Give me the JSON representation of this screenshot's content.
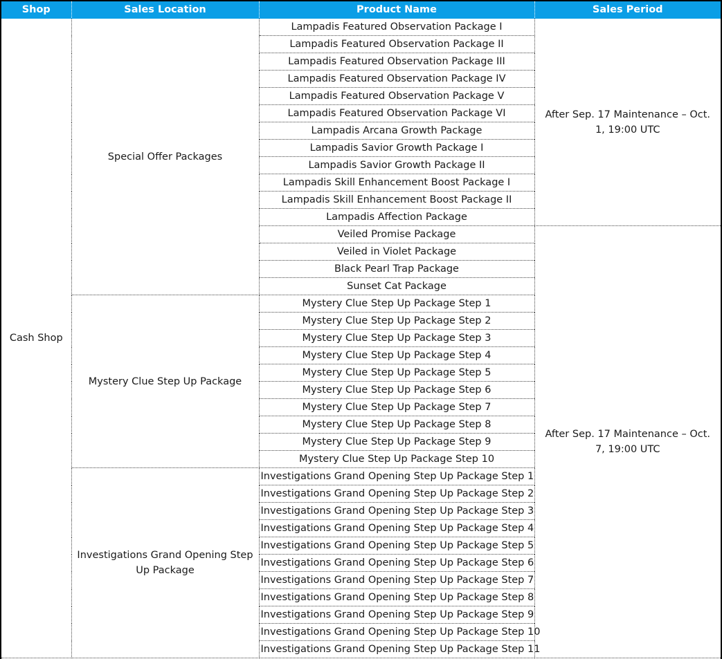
{
  "headers": {
    "shop": "Shop",
    "sales_location": "Sales Location",
    "product_name": "Product Name",
    "sales_period": "Sales Period"
  },
  "shop": "Cash Shop",
  "locations": [
    "Special Offer Packages",
    "Mystery Clue Step Up Package",
    "Investigations Grand Opening Step Up Package"
  ],
  "periods": [
    "After Sep. 17 Maintenance – Oct. 1, 19:00 UTC",
    "After Sep. 17 Maintenance – Oct. 7, 19:00 UTC"
  ],
  "products": [
    "Lampadis Featured Observation Package I",
    "Lampadis Featured Observation Package II",
    "Lampadis Featured Observation Package III",
    "Lampadis Featured Observation Package IV",
    "Lampadis Featured Observation Package V",
    "Lampadis Featured Observation Package VI",
    "Lampadis Arcana Growth Package",
    "Lampadis Savior Growth Package I",
    "Lampadis Savior Growth Package II",
    "Lampadis Skill Enhancement Boost Package I",
    "Lampadis Skill Enhancement Boost Package II",
    "Lampadis Affection Package",
    "Veiled Promise Package",
    "Veiled in Violet Package",
    "Black Pearl Trap Package",
    "Sunset Cat Package",
    "Mystery Clue Step Up Package Step 1",
    "Mystery Clue Step Up Package Step 2",
    "Mystery Clue Step Up Package Step 3",
    "Mystery Clue Step Up Package Step 4",
    "Mystery Clue Step Up Package Step 5",
    "Mystery Clue Step Up Package Step 6",
    "Mystery Clue Step Up Package Step 7",
    "Mystery Clue Step Up Package Step 8",
    "Mystery Clue Step Up Package Step 9",
    "Mystery Clue Step Up Package Step 10",
    "Investigations Grand Opening Step Up Package Step 1",
    "Investigations Grand Opening Step Up Package Step 2",
    "Investigations Grand Opening Step Up Package Step 3",
    "Investigations Grand Opening Step Up Package Step 4",
    "Investigations Grand Opening Step Up Package Step 5",
    "Investigations Grand Opening Step Up Package Step 6",
    "Investigations Grand Opening Step Up Package Step 7",
    "Investigations Grand Opening Step Up Package Step 8",
    "Investigations Grand Opening Step Up Package Step 9",
    "Investigations Grand Opening Step Up Package Step 10",
    "Investigations Grand Opening Step Up Package Step 11"
  ]
}
